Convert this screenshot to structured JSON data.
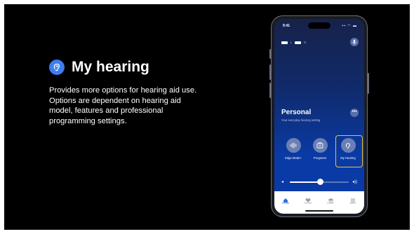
{
  "slide": {
    "title": "My hearing",
    "description": "Provides more options for hearing aid use. Options are dependent on hearing aid model, features and professional programming settings.",
    "accent_color": "#3d7df2",
    "title_icon": "ear-icon"
  },
  "phone": {
    "status_time": "9:41",
    "status_icons": "▪▪ ◠ ▬",
    "battery_left_label": "L",
    "battery_right_label": "R",
    "program_name": "Personal",
    "program_subtitle": "Your everyday hearing setting",
    "more_label": "•••",
    "actions": [
      {
        "label": "Edge Mode+",
        "icon": "waveform-icon"
      },
      {
        "label": "Programs",
        "icon": "programs-icon"
      },
      {
        "label": "My Hearing",
        "icon": "ear-icon"
      }
    ],
    "highlight_color": "#f2c12e",
    "volume_level": 0.52,
    "volume_low_icon": "◂",
    "volume_high_icon": "◂))",
    "tabs": [
      {
        "label": "Home",
        "icon": "home-icon",
        "active": true
      },
      {
        "label": "Health",
        "icon": "heart-icon",
        "active": false
      },
      {
        "label": "Learn",
        "icon": "graduation-cap-icon",
        "active": false
      },
      {
        "label": "More",
        "icon": "menu-icon",
        "active": false
      }
    ]
  }
}
